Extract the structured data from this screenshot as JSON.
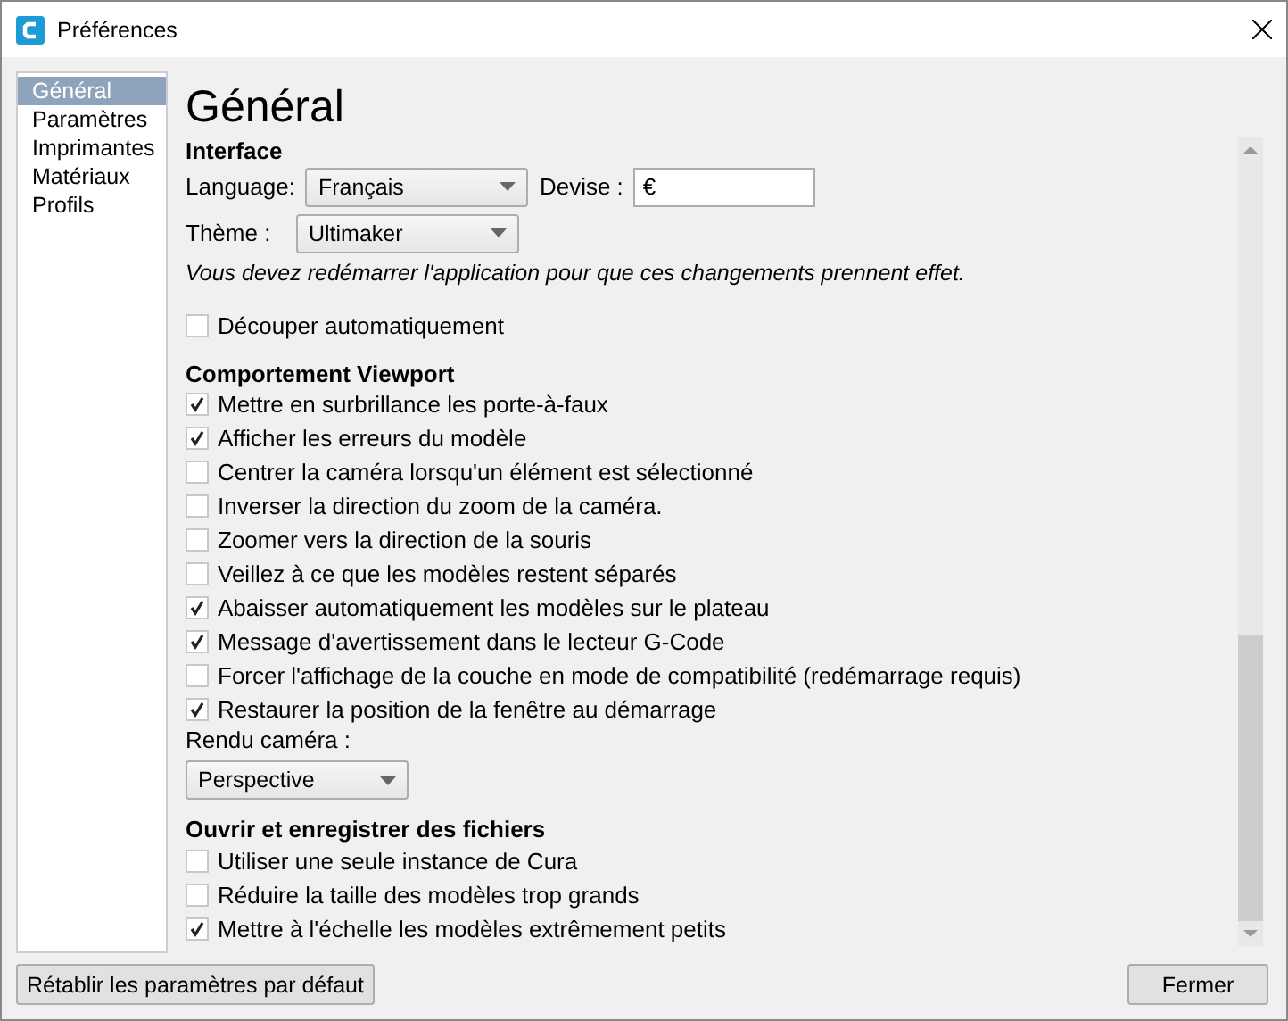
{
  "window": {
    "title": "Préférences"
  },
  "sidebar": {
    "items": [
      {
        "label": "Général",
        "selected": true
      },
      {
        "label": "Paramètres",
        "selected": false
      },
      {
        "label": "Imprimantes",
        "selected": false
      },
      {
        "label": "Matériaux",
        "selected": false
      },
      {
        "label": "Profils",
        "selected": false
      }
    ]
  },
  "page_title": "Général",
  "interface": {
    "heading": "Interface",
    "language_label": "Language:",
    "language_value": "Français",
    "currency_label": "Devise :",
    "currency_value": "€",
    "theme_label": "Thème :",
    "theme_value": "Ultimaker",
    "restart_note": "Vous devez redémarrer l'application pour que ces changements prennent effet.",
    "auto_slice": {
      "label": "Découper automatiquement",
      "checked": false
    }
  },
  "viewport": {
    "heading": "Comportement Viewport",
    "options": [
      {
        "label": "Mettre en surbrillance les porte-à-faux",
        "checked": true
      },
      {
        "label": "Afficher les erreurs du modèle",
        "checked": true
      },
      {
        "label": "Centrer la caméra lorsqu'un élément est sélectionné",
        "checked": false
      },
      {
        "label": "Inverser la direction du zoom de la caméra.",
        "checked": false
      },
      {
        "label": "Zoomer vers la direction de la souris",
        "checked": false
      },
      {
        "label": "Veillez à ce que les modèles restent séparés",
        "checked": false
      },
      {
        "label": "Abaisser automatiquement les modèles sur le plateau",
        "checked": true
      },
      {
        "label": "Message d'avertissement dans le lecteur G-Code",
        "checked": true
      },
      {
        "label": "Forcer l'affichage de la couche en mode de compatibilité (redémarrage requis)",
        "checked": false
      },
      {
        "label": "Restaurer la position de la fenêtre au démarrage",
        "checked": true
      }
    ],
    "camera_label": "Rendu caméra :",
    "camera_value": "Perspective"
  },
  "files": {
    "heading": "Ouvrir et enregistrer des fichiers",
    "options": [
      {
        "label": "Utiliser une seule instance de Cura",
        "checked": false
      },
      {
        "label": "Réduire la taille des modèles trop grands",
        "checked": false
      },
      {
        "label": "Mettre à l'échelle les modèles extrêmement petits",
        "checked": true
      }
    ]
  },
  "buttons": {
    "reset": "Rétablir les paramètres par défaut",
    "close": "Fermer"
  }
}
